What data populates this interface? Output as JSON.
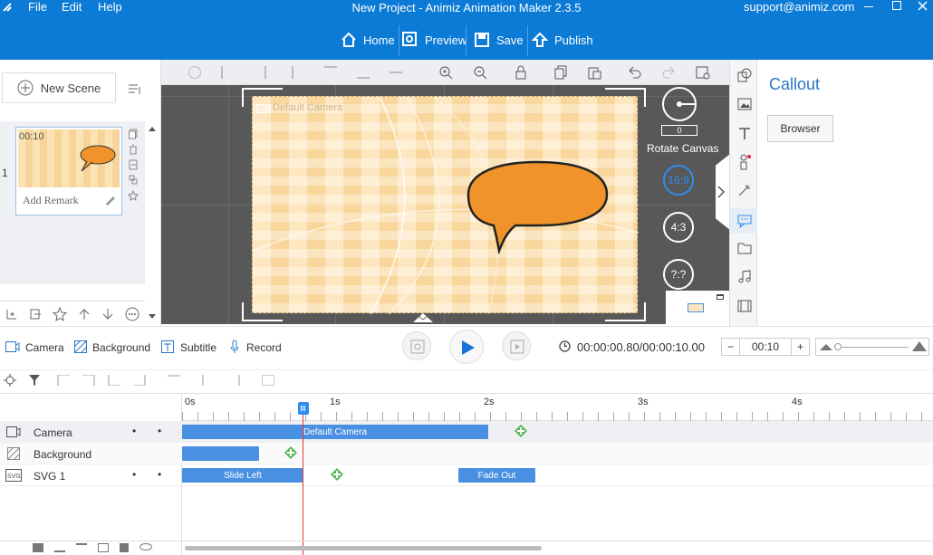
{
  "menu": {
    "file": "File",
    "edit": "Edit",
    "help": "Help"
  },
  "window": {
    "title": "New Project - Animiz Animation Maker 2.3.5",
    "support": "support@animiz.com"
  },
  "toolbar": {
    "home": "Home",
    "preview": "Preview",
    "save": "Save",
    "publish": "Publish"
  },
  "scenes": {
    "new_scene": "New Scene",
    "index": "1",
    "duration": "00:10",
    "remark": "Add Remark"
  },
  "canvas": {
    "camera_label": "Default Camera",
    "rotate_value": "0",
    "rotate_label": "Rotate Canvas",
    "ratio_169": "16:9",
    "ratio_43": "4:3",
    "ratio_custom": "?:?"
  },
  "props": {
    "title": "Callout",
    "browser": "Browser"
  },
  "timeline": {
    "camera": "Camera",
    "background": "Background",
    "subtitle": "Subtitle",
    "record": "Record",
    "time": "00:00:00.80/00:00:10.00",
    "duration": "00:10",
    "ticks": [
      "0s",
      "1s",
      "2s",
      "3s",
      "4s"
    ],
    "tracks": [
      {
        "name": "Camera"
      },
      {
        "name": "Background"
      },
      {
        "name": "SVG 1"
      }
    ],
    "clips": {
      "camera": "Default Camera",
      "slide": "Slide Left",
      "fade": "Fade Out"
    }
  },
  "colors": {
    "accent": "#0c7bd6",
    "clip": "#4a90e2",
    "callout": "#f0932b",
    "key": "#5bb85d"
  }
}
